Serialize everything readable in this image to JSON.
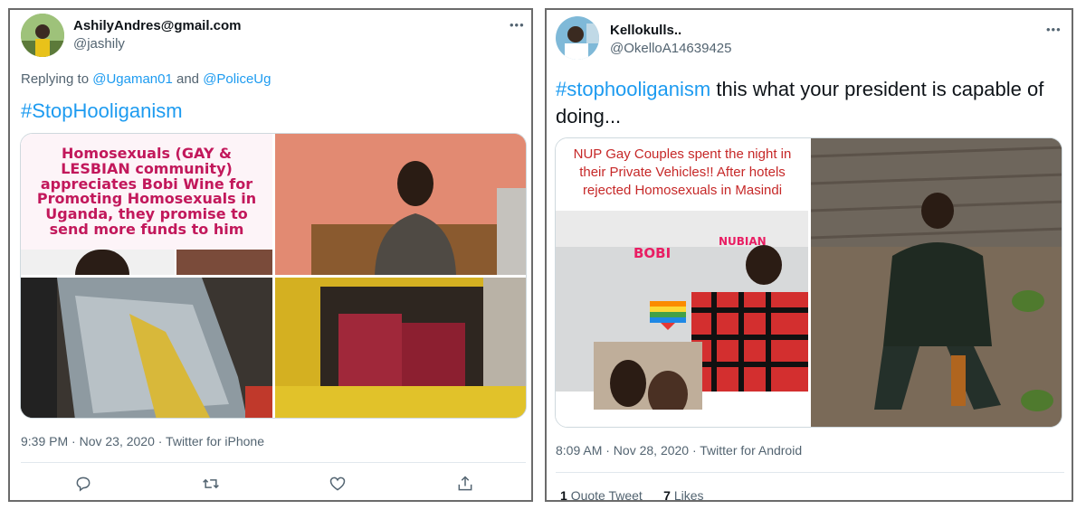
{
  "tweet1": {
    "author_name": "AshilyAndres@gmail.com",
    "author_handle": "@jashily",
    "more_icon": "more-horizontal-icon",
    "reply_prefix": "Replying to",
    "reply_user1": "@Ugaman01",
    "reply_and": "and",
    "reply_user2": "@PoliceUg",
    "text_hashtag": "#StopHooliganism",
    "image_caption": "Homosexuals (GAY & LESBIAN community) appreciates Bobi Wine for Promoting Homosexuals in Uganda, they promise to send more funds to him",
    "timestamp": "9:39 PM · Nov 23, 2020 · Twitter for iPhone",
    "actions": [
      "reply-icon",
      "retweet-icon",
      "like-icon",
      "share-icon"
    ]
  },
  "tweet2": {
    "author_name": "Kellokulls..",
    "author_handle": "@OkelloA14639425",
    "more_icon": "more-horizontal-icon",
    "text_hashtag": "#stophooliganism",
    "text_body": " this what your president is capable of doing...",
    "image_caption": "NUP Gay Couples spent the night in their Private Vehicles!! After hotels rejected Homosexuals in Masindi",
    "image_label_left": "BOBI",
    "image_label_right": "NUBIAN",
    "timestamp": "8:09 AM · Nov 28, 2020 · Twitter for Android",
    "quote_count": "1",
    "quote_label": "Quote Tweet",
    "like_count": "7",
    "like_label": "Likes"
  },
  "colors": {
    "link": "#1d9bf0",
    "secondary_text": "#536471",
    "caption_magenta": "#c2185b",
    "caption_red": "#c62828"
  }
}
